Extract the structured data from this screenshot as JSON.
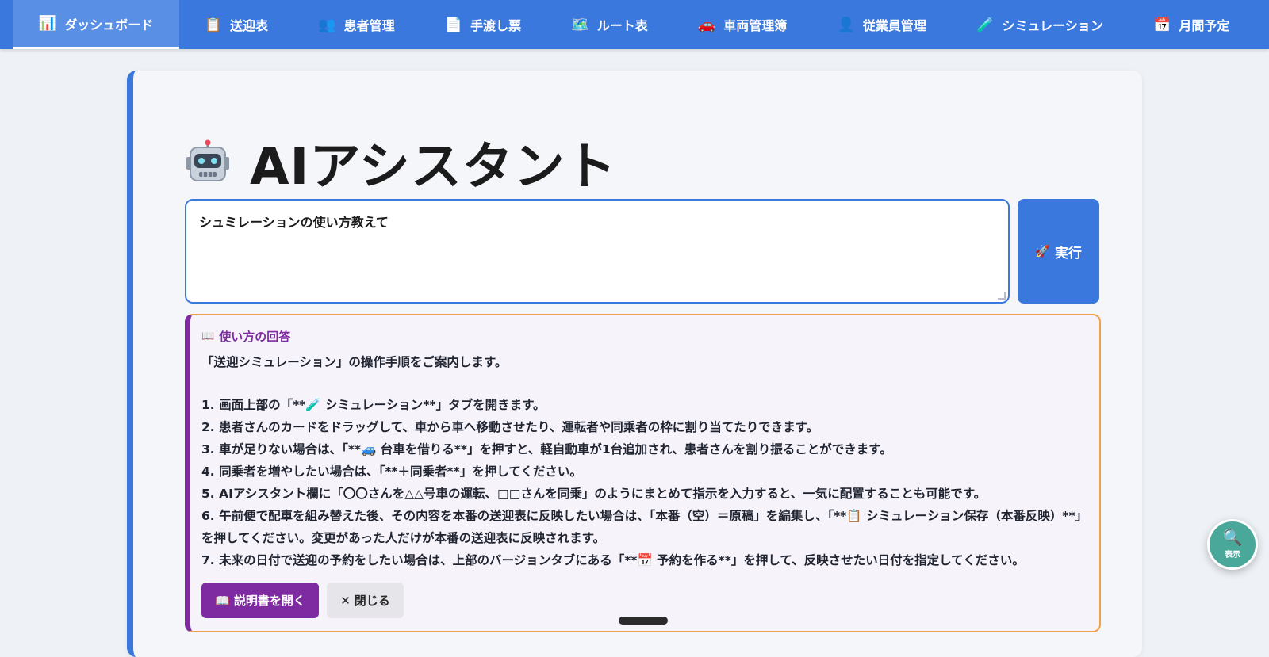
{
  "nav": {
    "tabs": [
      {
        "icon": "📊",
        "label": "ダッシュボード",
        "active": true
      },
      {
        "icon": "📋",
        "label": "送迎表"
      },
      {
        "icon": "👥",
        "label": "患者管理"
      },
      {
        "icon": "📄",
        "label": "手渡し票"
      },
      {
        "icon": "🗺️",
        "label": "ルート表"
      },
      {
        "icon": "🚗",
        "label": "車両管理簿"
      },
      {
        "icon": "👤",
        "label": "従業員管理"
      },
      {
        "icon": "🧪",
        "label": "シミュレーション"
      },
      {
        "icon": "📅",
        "label": "月間予定"
      }
    ]
  },
  "page": {
    "icon": "robot",
    "title": "AIアシスタント"
  },
  "prompt": {
    "value": "シュミレーションの使い方教えて",
    "run_icon": "🚀",
    "run_label": "実行"
  },
  "answer": {
    "head_icon": "📖",
    "heading": "使い方の回答",
    "intro": "「送迎シミュレーション」の操作手順をご案内します。",
    "steps": [
      "1.  画面上部の「**🧪 シミュレーション**」タブを開きます。",
      "2.  患者さんのカードをドラッグして、車から車へ移動させたり、運転者や同乗者の枠に割り当てたりできます。",
      "3.  車が足りない場合は、「**🚙 台車を借りる**」を押すと、軽自動車が1台追加され、患者さんを割り振ることができます。",
      "4.  同乗者を増やしたい場合は、「**＋同乗者**」を押してください。",
      "5.  AIアシスタント欄に「〇〇さんを△△号車の運転、□□さんを同乗」のようにまとめて指示を入力すると、一気に配置することも可能です。",
      "6.  午前便で配車を組み替えた後、その内容を本番の送迎表に反映したい場合は、「本番（空）＝原稿」を編集し、「**📋 シミュレーション保存（本番反映）**」を押してください。変更があった人だけが本番の送迎表に反映されます。",
      "7.  未来の日付で送迎の予約をしたい場合は、上部のバージョンタブにある「**📅 予約を作る**」を押して、反映させたい日付を指定してください。"
    ],
    "open_manual_icon": "📖",
    "open_manual_label": "説明書を開く",
    "close_icon": "✕",
    "close_label": "閉じる"
  },
  "fab": {
    "icon": "🔍",
    "label": "表示"
  },
  "colors": {
    "nav": "#3b78de",
    "accent_purple": "#7e2ba1",
    "answer_border": "#f0a04b",
    "fab": "#4aa89a"
  }
}
